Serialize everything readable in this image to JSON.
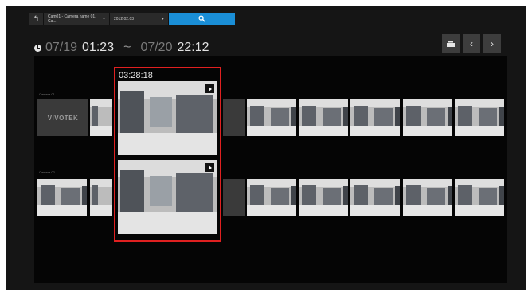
{
  "toolbar": {
    "back_icon": "return-arrow-icon",
    "camera_select": "Cam01 - Camera name 01, Ca...",
    "date_select": "2012.02.03",
    "search_icon": "search-icon"
  },
  "time_range": {
    "start_date": "07/19",
    "start_time": "01:23",
    "separator": "~",
    "end_date": "07/20",
    "end_time": "22:12"
  },
  "nav": {
    "sync_icon": "sync-playback-icon",
    "prev_icon": "chevron-left-icon",
    "next_icon": "chevron-right-icon"
  },
  "cameras": [
    {
      "label": "Camera 01",
      "logo": "VIVOTEK"
    },
    {
      "label": "Camera 02"
    }
  ],
  "highlight": {
    "timestamp": "03:28:18",
    "play_icon": "play-icon"
  },
  "colors": {
    "accent": "#1a8ed6",
    "highlight_border": "#e02020",
    "background": "#151515"
  }
}
